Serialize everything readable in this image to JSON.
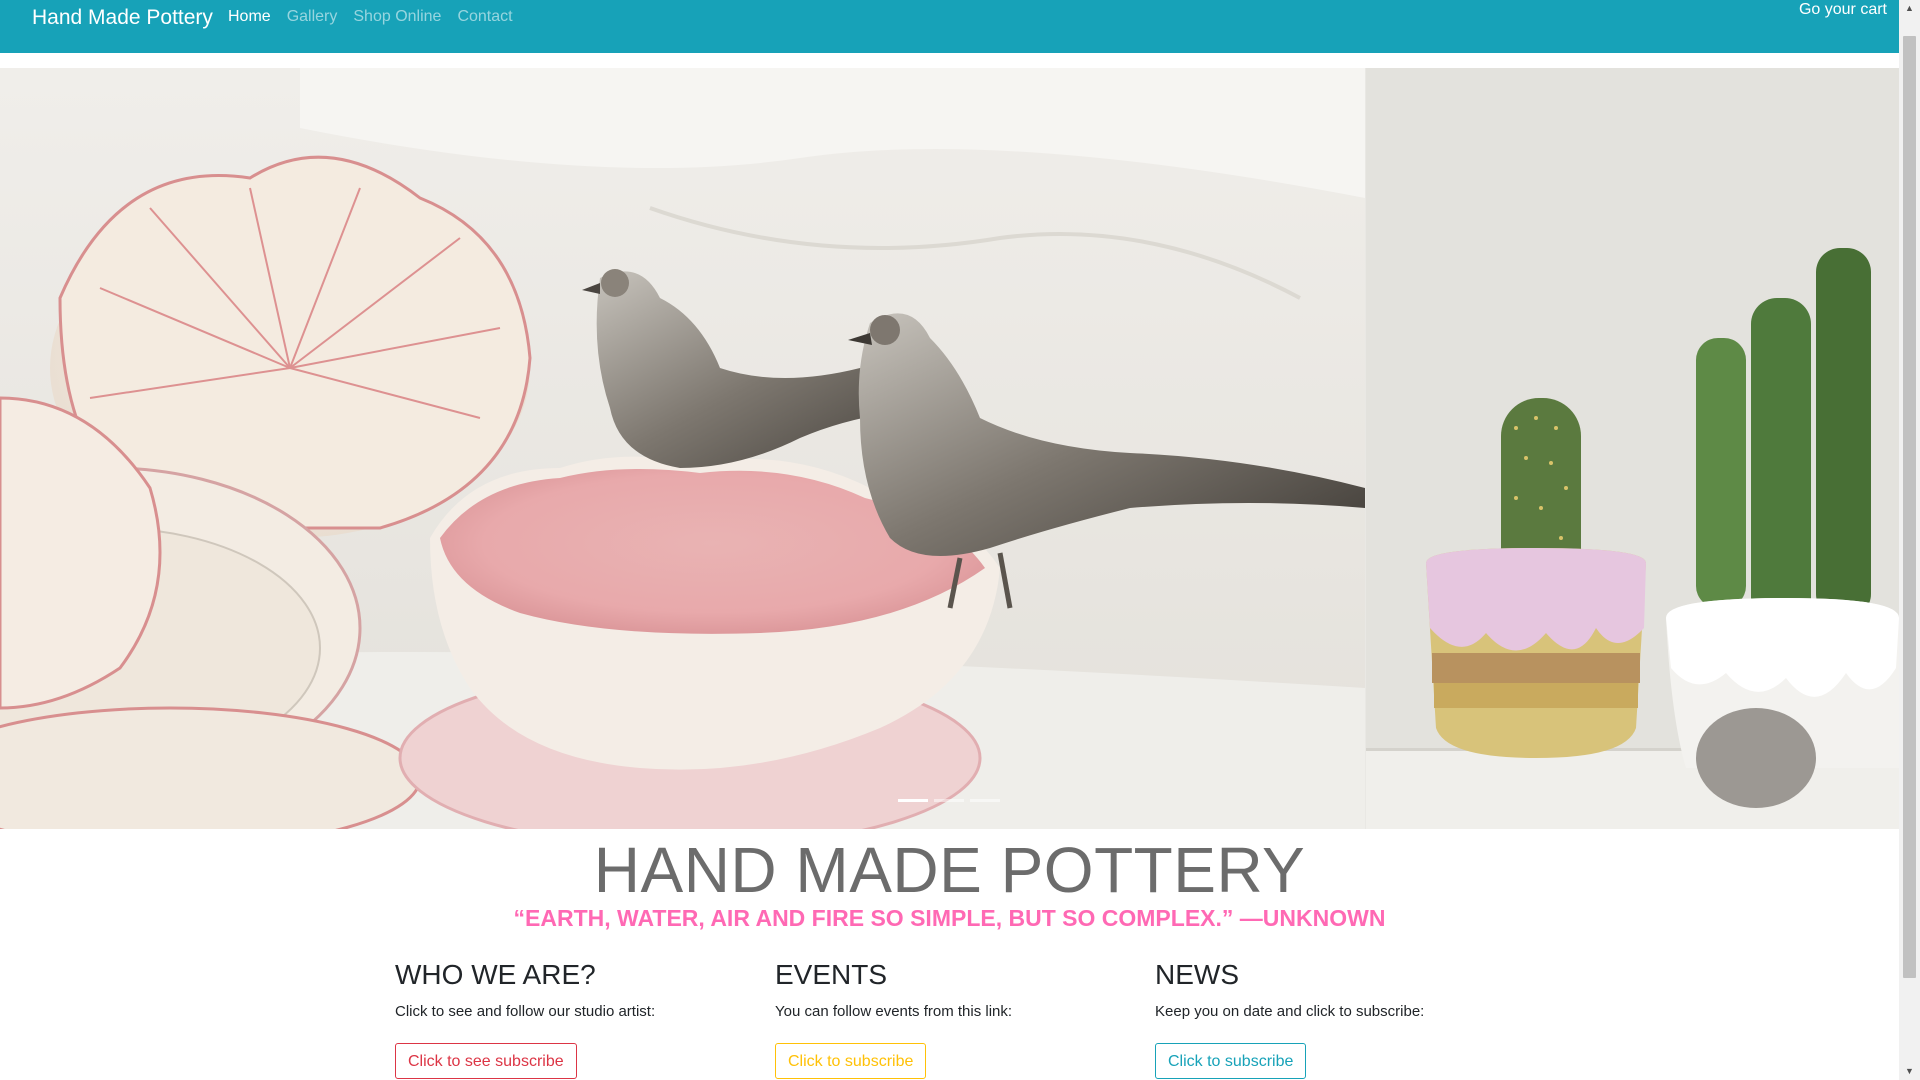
{
  "navbar": {
    "brand": "Hand Made Pottery",
    "links": [
      {
        "label": "Home",
        "active": true
      },
      {
        "label": "Gallery",
        "active": false
      },
      {
        "label": "Shop Online",
        "active": false
      },
      {
        "label": "Contact",
        "active": false
      }
    ],
    "cart_label": "Go your cart"
  },
  "carousel": {
    "slides": [
      {
        "subject": "pink flower-shaped ceramic bowls with silver pheasant figurines"
      },
      {
        "subject": "pink and striped glazed planters with cacti"
      }
    ],
    "indicator_count": 3,
    "active_indicator": 0
  },
  "hero": {
    "title": "HAND MADE POTTERY",
    "quote": "“EARTH, WATER, AIR AND FIRE SO SIMPLE, BUT SO COMPLEX.” —UNKNOWN"
  },
  "columns": [
    {
      "heading": "WHO WE ARE?",
      "text": "Click to see and follow our studio artist:",
      "button": "Click to see subscribe"
    },
    {
      "heading": "EVENTS",
      "text": "You can follow events from this link:",
      "button": "Click to subscribe"
    },
    {
      "heading": "NEWS",
      "text": "Keep you on date and click to subscribe:",
      "button": "Click to subscribe"
    }
  ],
  "colors": {
    "navbar": "#17a2b8",
    "quote": "#ff69b4",
    "title": "#6c6c6c",
    "btn_red": "#dc3545",
    "btn_yellow": "#ffc107",
    "btn_teal": "#17a2b8"
  }
}
